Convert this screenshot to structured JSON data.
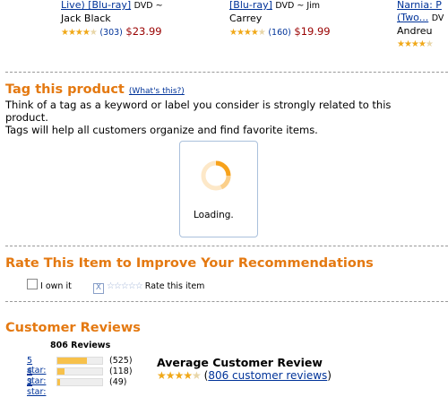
{
  "products": [
    {
      "title": "Live) [Blu-ray]",
      "format": "DVD ~",
      "byline": "Jack Black",
      "stars": 4.5,
      "reviews": "(303)",
      "price": "$23.99"
    },
    {
      "title": "[Blu-ray]",
      "format": "DVD ~ Jim",
      "byline": "Carrey",
      "stars": 4.5,
      "reviews": "(160)",
      "price": "$19.99"
    },
    {
      "title": "Narnia: P",
      "title2": "(Two...",
      "format": "DV",
      "byline": "Andreu",
      "stars": 4.0
    }
  ],
  "tag": {
    "title": "Tag this product",
    "whats_this": "(What's this?)",
    "line1": "Think of a tag as a keyword or label you consider is strongly related to this",
    "line2": "product.",
    "line3": "Tags will help all customers organize and find favorite items.",
    "loading": "Loading."
  },
  "rate": {
    "title": "Rate This Item to Improve Your Recommendations",
    "own_label": "I own it",
    "rate_label": "Rate this item"
  },
  "reviews": {
    "title": "Customer Reviews",
    "total": "806 Reviews",
    "histogram": [
      {
        "label": "5 star:",
        "count": "(525)",
        "fraction": 0.65
      },
      {
        "label": "4 star:",
        "count": "(118)",
        "fraction": 0.15
      },
      {
        "label": "3 star:",
        "count": "(49)",
        "fraction": 0.06
      }
    ],
    "avg_title": "Average Customer Review",
    "avg_stars": 4.0,
    "avg_link": "806 customer reviews",
    "avg_open": "(",
    "avg_close": ")"
  },
  "colors": {
    "accent": "#e47911",
    "link": "#003399",
    "price": "#990000",
    "star": "#f0a818"
  }
}
